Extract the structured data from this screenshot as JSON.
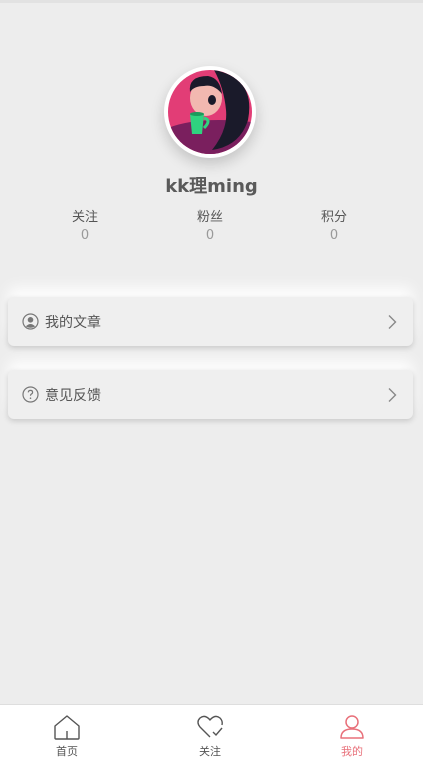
{
  "profile": {
    "username": "kk理ming",
    "stats": [
      {
        "label": "关注",
        "value": "0"
      },
      {
        "label": "粉丝",
        "value": "0"
      },
      {
        "label": "积分",
        "value": "0"
      }
    ]
  },
  "menu": [
    {
      "label": "我的文章",
      "icon": "user-circle-icon"
    },
    {
      "label": "意见反馈",
      "icon": "question-circle-icon"
    }
  ],
  "tabbar": {
    "items": [
      {
        "label": "首页",
        "icon": "home-icon",
        "active": false
      },
      {
        "label": "关注",
        "icon": "heart-check-icon",
        "active": false
      },
      {
        "label": "我的",
        "icon": "user-icon",
        "active": true
      }
    ],
    "active_color": "#e8707a",
    "inactive_color": "#555555"
  }
}
